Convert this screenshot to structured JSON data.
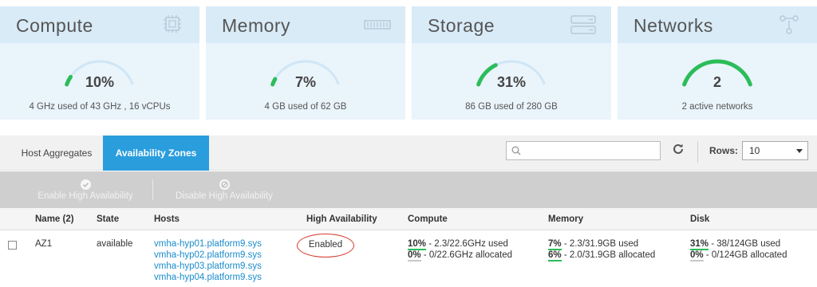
{
  "cards": [
    {
      "title": "Compute",
      "icon": "cpu-chip-icon",
      "value": "10%",
      "subtitle": "4 GHz used of 43 GHz , 16 vCPUs",
      "fraction": 0.1
    },
    {
      "title": "Memory",
      "icon": "memory-module-icon",
      "value": "7%",
      "subtitle": "4 GB used of 62 GB",
      "fraction": 0.07
    },
    {
      "title": "Storage",
      "icon": "server-stack-icon",
      "value": "31%",
      "subtitle": "86 GB used of 280 GB",
      "fraction": 0.31
    },
    {
      "title": "Networks",
      "icon": "network-icon",
      "value": "2",
      "subtitle": "2 active networks",
      "fraction": 1.0
    }
  ],
  "tabs": {
    "host_aggregates": "Host Aggregates",
    "availability_zones": "Availability Zones",
    "active": "availability_zones"
  },
  "search": {
    "placeholder": "",
    "value": ""
  },
  "rows_control": {
    "label": "Rows:",
    "selected": "10"
  },
  "actions": {
    "enable_ha": "Enable High Availability",
    "disable_ha": "Disable High Availability"
  },
  "table": {
    "headers": {
      "name": "Name (2)",
      "state": "State",
      "hosts": "Hosts",
      "ha": "High Availability",
      "compute": "Compute",
      "memory": "Memory",
      "disk": "Disk"
    },
    "rows": [
      {
        "name": "AZ1",
        "state": "available",
        "hosts": [
          "vmha-hyp01.platform9.sys",
          "vmha-hyp02.platform9.sys",
          "vmha-hyp03.platform9.sys",
          "vmha-hyp04.platform9.sys"
        ],
        "ha": "Enabled",
        "compute": {
          "used_pct": "10%",
          "used": " - 2.3/22.6GHz used",
          "alloc_pct": "0%",
          "alloc": " - 0/22.6GHz allocated"
        },
        "memory": {
          "used_pct": "7%",
          "used": " - 2.3/31.9GB used",
          "alloc_pct": "6%",
          "alloc": " - 2.0/31.9GB allocated"
        },
        "disk": {
          "used_pct": "31%",
          "used": " - 38/124GB used",
          "alloc_pct": "0%",
          "alloc": " - 0/124GB allocated"
        }
      }
    ]
  },
  "colors": {
    "accent": "#2a9ddd",
    "gauge_fill": "#2bbd5a",
    "gauge_track": "#cfe6f6",
    "link": "#1a8ccc",
    "highlight_circle": "#d9362b"
  }
}
